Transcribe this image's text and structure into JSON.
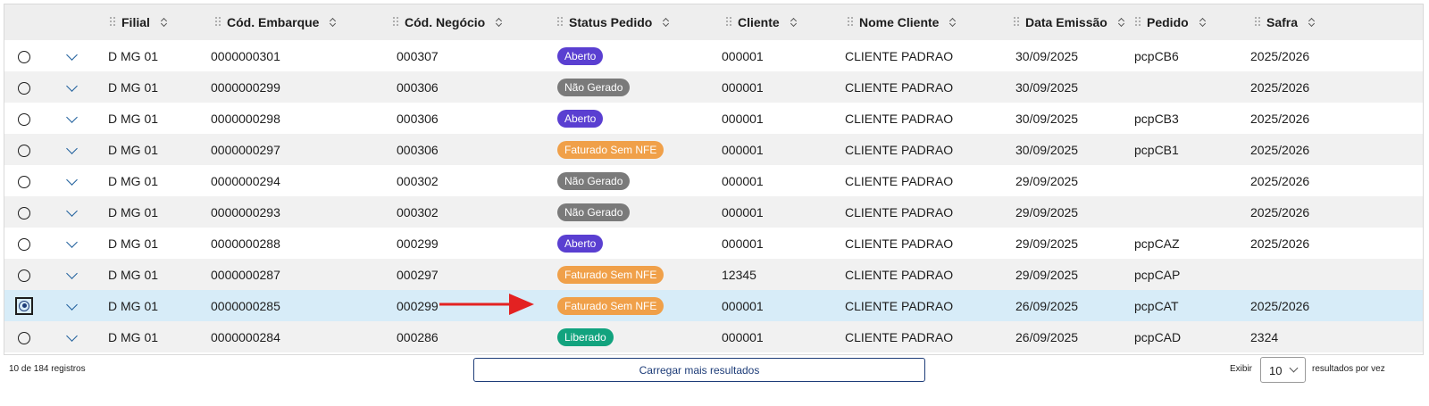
{
  "columns": [
    {
      "label": "Filial"
    },
    {
      "label": "Cód. Embarque"
    },
    {
      "label": "Cód. Negócio"
    },
    {
      "label": "Status Pedido"
    },
    {
      "label": "Cliente"
    },
    {
      "label": "Nome Cliente"
    },
    {
      "label": "Data Emissão"
    },
    {
      "label": "Pedido"
    },
    {
      "label": "Safra"
    }
  ],
  "status_colors": {
    "Aberto": "#5a3fd1",
    "Não Gerado": "#7a7a7a",
    "Faturado Sem NFE": "#f0a049",
    "Liberado": "#12a37e"
  },
  "colors": {
    "selected_row": "#d7ecf8",
    "accent": "#1d3c78",
    "arrow": "#e32222"
  },
  "rows": [
    {
      "filial": "D MG 01",
      "embarque": "0000000301",
      "negocio": "000307",
      "status": "Aberto",
      "cliente": "000001",
      "nome": "CLIENTE PADRAO",
      "data": "30/09/2025",
      "pedido": "pcpCB6",
      "safra": "2025/2026",
      "selected": false
    },
    {
      "filial": "D MG 01",
      "embarque": "0000000299",
      "negocio": "000306",
      "status": "Não Gerado",
      "cliente": "000001",
      "nome": "CLIENTE PADRAO",
      "data": "30/09/2025",
      "pedido": "",
      "safra": "2025/2026",
      "selected": false
    },
    {
      "filial": "D MG 01",
      "embarque": "0000000298",
      "negocio": "000306",
      "status": "Aberto",
      "cliente": "000001",
      "nome": "CLIENTE PADRAO",
      "data": "30/09/2025",
      "pedido": "pcpCB3",
      "safra": "2025/2026",
      "selected": false
    },
    {
      "filial": "D MG 01",
      "embarque": "0000000297",
      "negocio": "000306",
      "status": "Faturado Sem NFE",
      "cliente": "000001",
      "nome": "CLIENTE PADRAO",
      "data": "30/09/2025",
      "pedido": "pcpCB1",
      "safra": "2025/2026",
      "selected": false
    },
    {
      "filial": "D MG 01",
      "embarque": "0000000294",
      "negocio": "000302",
      "status": "Não Gerado",
      "cliente": "000001",
      "nome": "CLIENTE PADRAO",
      "data": "29/09/2025",
      "pedido": "",
      "safra": "2025/2026",
      "selected": false
    },
    {
      "filial": "D MG 01",
      "embarque": "0000000293",
      "negocio": "000302",
      "status": "Não Gerado",
      "cliente": "000001",
      "nome": "CLIENTE PADRAO",
      "data": "29/09/2025",
      "pedido": "",
      "safra": "2025/2026",
      "selected": false
    },
    {
      "filial": "D MG 01",
      "embarque": "0000000288",
      "negocio": "000299",
      "status": "Aberto",
      "cliente": "000001",
      "nome": "CLIENTE PADRAO",
      "data": "29/09/2025",
      "pedido": "pcpCAZ",
      "safra": "2025/2026",
      "selected": false
    },
    {
      "filial": "D MG 01",
      "embarque": "0000000287",
      "negocio": "000297",
      "status": "Faturado Sem NFE",
      "cliente": "12345",
      "nome": "CLIENTE PADRAO",
      "data": "29/09/2025",
      "pedido": "pcpCAP",
      "safra": "",
      "selected": false
    },
    {
      "filial": "D MG 01",
      "embarque": "0000000285",
      "negocio": "000299",
      "status": "Faturado Sem NFE",
      "cliente": "000001",
      "nome": "CLIENTE PADRAO",
      "data": "26/09/2025",
      "pedido": "pcpCAT",
      "safra": "2025/2026",
      "selected": true
    },
    {
      "filial": "D MG 01",
      "embarque": "0000000284",
      "negocio": "000286",
      "status": "Liberado",
      "cliente": "000001",
      "nome": "CLIENTE PADRAO",
      "data": "26/09/2025",
      "pedido": "pcpCAD",
      "safra": "2324",
      "selected": false
    }
  ],
  "footer": {
    "count": "10 de 184 registros",
    "load_more": "Carregar mais resultados",
    "exibir": "Exibir",
    "page_size": "10",
    "per_page_suffix": "resultados por vez"
  },
  "icons": {
    "row_expand": "chevron-down-icon",
    "column_grip": "drag-handle-icon",
    "column_sort": "sort-icon",
    "annotation": "red-arrow-icon"
  }
}
